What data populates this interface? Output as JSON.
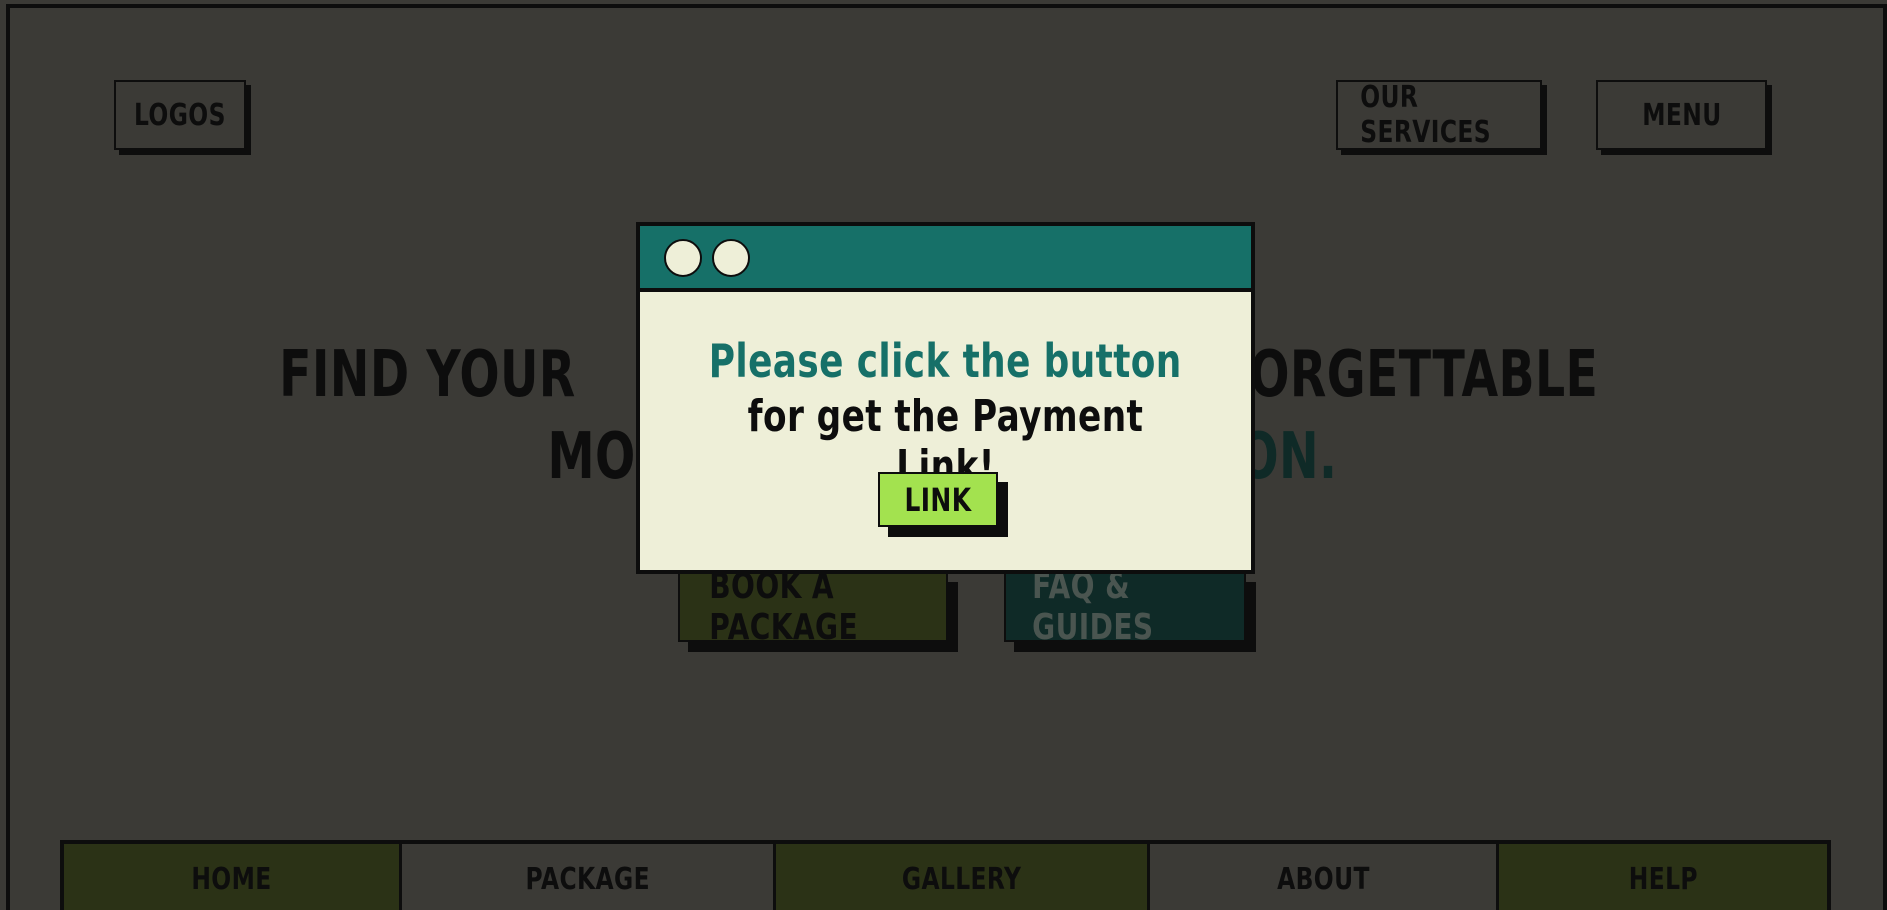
{
  "header": {
    "logo_label": "LOGOS",
    "services_label": "OUR SERVICES",
    "menu_label": "MENU"
  },
  "hero": {
    "line1_left": "FIND YOUR",
    "line1_right": "ORGETTABLE",
    "line2_left": "MO",
    "line2_right": "ON."
  },
  "cta": {
    "book_label": "BOOK A PACKAGE",
    "faq_label": "FAQ & GUIDES"
  },
  "nav": {
    "items": [
      {
        "label": "HOME"
      },
      {
        "label": "PACKAGE"
      },
      {
        "label": "GALLERY"
      },
      {
        "label": "ABOUT"
      },
      {
        "label": "HELP"
      }
    ]
  },
  "modal": {
    "title": "Please click the button",
    "subtitle": "for get the Payment Link!",
    "link_label": "LINK"
  },
  "colors": {
    "background": "#3b3a36",
    "modal_header": "#167068",
    "modal_body": "#eeefd8",
    "link_button": "#a3e24f",
    "dark_green": "#2b3216",
    "dark_teal": "#0f2a27"
  },
  "icons": [
    "window-dot-icon",
    "window-dot-icon"
  ]
}
